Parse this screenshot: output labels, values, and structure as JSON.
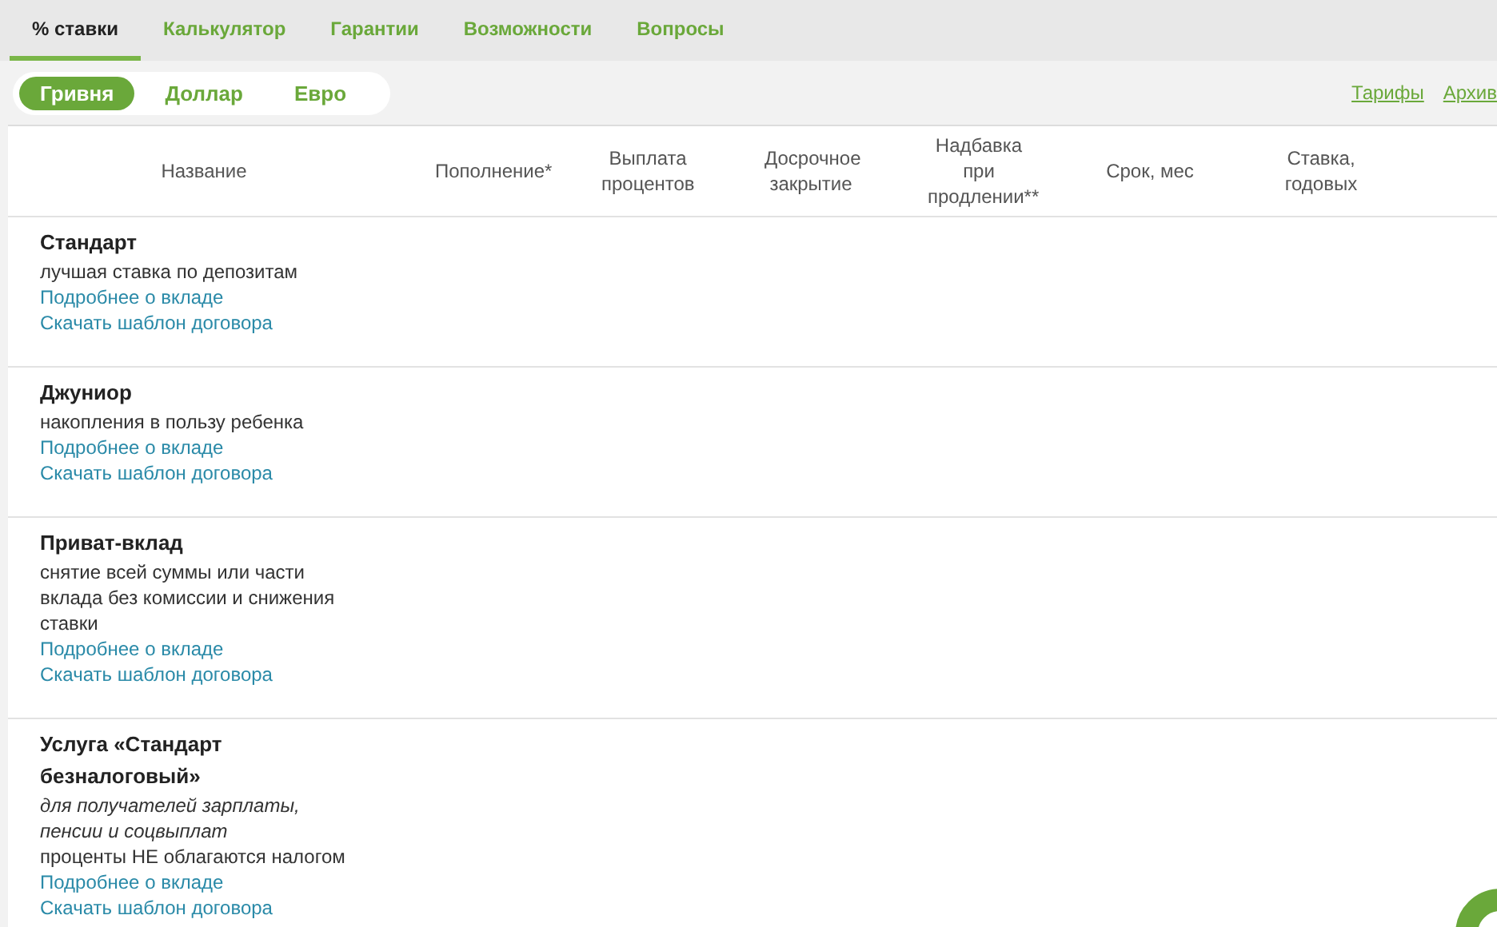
{
  "tabs": [
    {
      "label": "% ставки",
      "selected": true
    },
    {
      "label": "Калькулятор",
      "selected": false
    },
    {
      "label": "Гарантии",
      "selected": false
    },
    {
      "label": "Возможности",
      "selected": false
    },
    {
      "label": "Вопросы",
      "selected": false
    }
  ],
  "currencies": [
    {
      "label": "Гривня",
      "selected": true
    },
    {
      "label": "Доллар",
      "selected": false
    },
    {
      "label": "Евро",
      "selected": false
    }
  ],
  "links": [
    "Тарифы",
    "Архив"
  ],
  "table": {
    "columns": [
      "Название",
      "Пополнение*",
      "Выплата процентов",
      "Досрочное закрытие",
      "Надбавка при продлении**",
      "Срок, мес",
      "Ставка, годовых"
    ],
    "rows": [
      {
        "title": "Стандарт",
        "description": "лучшая ставка по депозитам",
        "links": [
          "Подробнее о вкладе",
          "Скачать шаблон договора"
        ]
      },
      {
        "title": "Джуниор",
        "description": "накопления в пользу ребенка",
        "links": [
          "Подробнее о вкладе",
          "Скачать шаблон договора"
        ]
      },
      {
        "title": "Приват-вклад",
        "description": "снятие всей суммы или части вклада без комиссии и снижения ставки",
        "links": [
          "Подробнее о вкладе",
          "Скачать шаблон договора"
        ]
      },
      {
        "title": "Услуга «Стандарт безналоговый»",
        "note": "для получателей зарплаты, пенсии и соцвыплат",
        "description": "проценты НЕ облагаются налогом",
        "links": [
          "Подробнее о вкладе",
          "Скачать шаблон договора"
        ]
      }
    ]
  }
}
